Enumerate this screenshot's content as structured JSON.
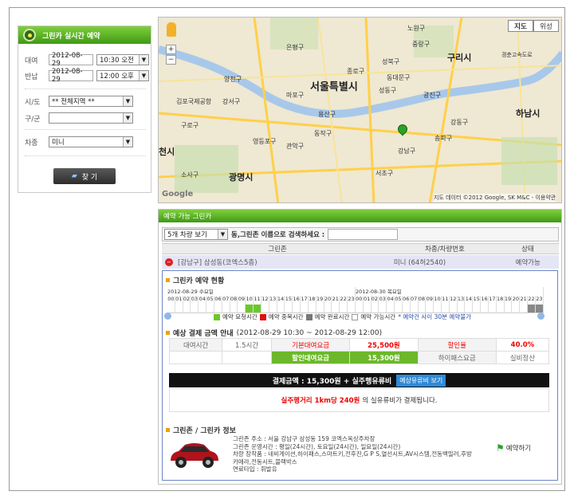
{
  "left_panel": {
    "title": "그린카 실시간 예약",
    "rent_label": "대여",
    "rent_date": "2012-08-29",
    "rent_time": "10:30 오전",
    "return_label": "반납",
    "return_date": "2012-08-29",
    "return_time": "12:00 오후",
    "city_label": "시/도",
    "city_value": "** 전체지역 **",
    "district_label": "구/군",
    "district_value": "",
    "car_label": "차종",
    "car_value": "미니",
    "search_button": "찾 기"
  },
  "map": {
    "tab_map": "지도",
    "tab_satellite": "위성",
    "zoom_in": "+",
    "zoom_out": "−",
    "city_main": "서울특별시",
    "guri": "구리시",
    "hanam": "하남시",
    "gwangmyeong": "광명시",
    "eunpyeong": "은평구",
    "jungnang": "중랑구",
    "nowon": "노원구",
    "gangseo": "강서구",
    "yongsan": "용산구",
    "dongjak": "동작구",
    "gwanak": "관악구",
    "seocho": "서초구",
    "songpa": "송파구",
    "gangdong": "강동구",
    "guro": "구로구",
    "mapo": "마포구",
    "yeongdeungpo": "영등포구",
    "jongno": "종로구",
    "seongbuk": "성북구",
    "seongdong": "성동구",
    "dongdaemun": "동대문구",
    "gwangjin": "광진구",
    "gimpo_airport": "김포국제공항",
    "gangnam": "강남구",
    "yangcheon": "양천구",
    "sosa": "소사구",
    "bucheon": "천시",
    "copyright": "지도 데이터 ©2012 Google, SK M&C - 이용약관",
    "google": "Google",
    "road1": "경춘고속도로"
  },
  "list": {
    "header": "예약 가능 그린카",
    "view_select": "5개 차량 보기",
    "search_label": "동,그린존 이름으로 검색하세요 :",
    "search_value": "",
    "col_zone": "그린존",
    "col_car": "차종/차량번호",
    "col_status": "상태",
    "row_zone": "[강남구] 삼성동(코엑스5층)",
    "row_car": "미니 (64허2540)",
    "row_status": "예약가능"
  },
  "status": {
    "title": "그린카 예약 현황",
    "day1": "2012-08-29 수요일",
    "day2": "2012-08-30 목요일",
    "hours": [
      "00",
      "01",
      "02",
      "03",
      "04",
      "05",
      "06",
      "07",
      "08",
      "09",
      "10",
      "11",
      "12",
      "13",
      "14",
      "15",
      "16",
      "17",
      "18",
      "19",
      "20",
      "21",
      "22",
      "23",
      "00",
      "01",
      "02",
      "03",
      "04",
      "05",
      "06",
      "07",
      "08",
      "09",
      "10",
      "11",
      "12",
      "13",
      "14",
      "15",
      "16",
      "17",
      "18",
      "19",
      "20",
      "21",
      "22",
      "23"
    ],
    "legend_request": "예약 요청시간",
    "legend_dup": "예약 중복시간",
    "legend_done": "예약 완료시간",
    "legend_avail": "예약 가능시간",
    "legend_note": "* 예약건 사이 30분 예약불가"
  },
  "price": {
    "title": "예상 결제 금액 안내",
    "period": "(2012-08-29 10:30 ~ 2012-08-29 12:00)",
    "rent_time_label": "대여시간",
    "rent_time_value": "1.5시간",
    "base_label": "기본대여요금",
    "base_value": "25,500원",
    "discount_label": "할인율",
    "discount_value": "40.0%",
    "discounted_label": "할인대여요금",
    "discounted_value": "15,300원",
    "hipass_label": "하이패스요금",
    "hipass_value": "실비정산",
    "total_text": "결제금액 : 15,300원 + 실주행유류비",
    "fuel_button": "예상유류비 보기",
    "warn_text": "실주행거리 1km당 240원",
    "warn_suffix": "의 실유류비가 결제됩니다."
  },
  "zone": {
    "title": "그린존 / 그린카 정보",
    "address": "그린존 주소 : 서울 강남구 삼성동 159 코엑스옥상주차장",
    "hours": "그린존 운영시간 : 평일(24시간), 토요일(24시간), 일요일(24시간)",
    "options": "차량 장착품 : 네비게이션,하이패스,스마트키,전후진,G P S,열선시트,AV시스템,전동백밀러,후방",
    "options2": "카메라,전동시트,블랙박스",
    "fuel": "연료타입 : 휘발유",
    "reserve_button": "예약하기"
  }
}
